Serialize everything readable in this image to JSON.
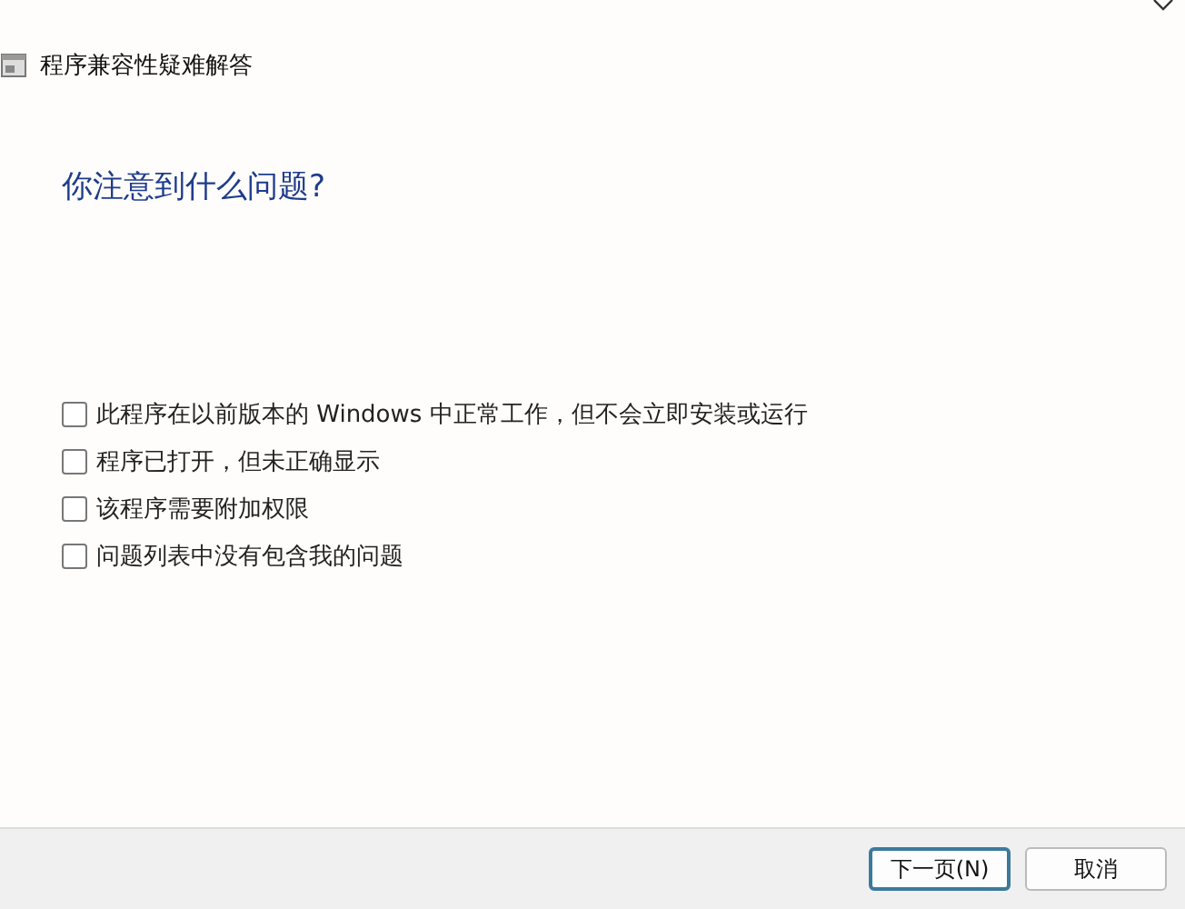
{
  "window": {
    "title": "程序兼容性疑难解答"
  },
  "heading": "你注意到什么问题?",
  "options": [
    {
      "label": "此程序在以前版本的 Windows 中正常工作，但不会立即安装或运行",
      "checked": false
    },
    {
      "label": "程序已打开，但未正确显示",
      "checked": false
    },
    {
      "label": "该程序需要附加权限",
      "checked": false
    },
    {
      "label": "问题列表中没有包含我的问题",
      "checked": false
    }
  ],
  "buttons": [
    {
      "label": "下一页(N)",
      "default": true
    },
    {
      "label": "取消",
      "default": false
    }
  ]
}
